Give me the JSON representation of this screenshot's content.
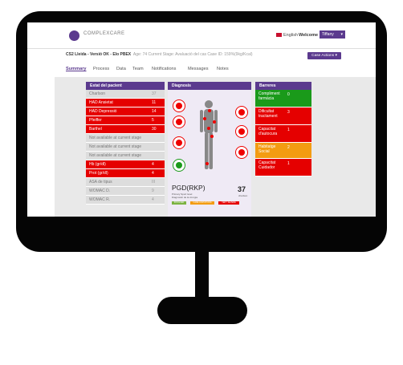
{
  "header": {
    "logo_text": "COMPLEXCARE",
    "language": "English",
    "welcome_label": "Welcome",
    "user_name": "Tiffany"
  },
  "case": {
    "title": "CS2 Lleida - Versió OK - Elo PBEX",
    "meta": "Age: 74  Current Stage: Avaluació del cas  Case ID: 159%(9kg/Kcal)",
    "actions_label": "Case Actions"
  },
  "tabs": [
    "Summary",
    "Process",
    "Data",
    "Team",
    "Notifications",
    "Messages",
    "Notes"
  ],
  "patient_panel": {
    "title": "Estat del pacient",
    "rows": [
      {
        "label": "Charlson",
        "value": "37",
        "status": "grey"
      },
      {
        "label": "HAD Ansietat",
        "value": "11",
        "status": "red"
      },
      {
        "label": "HAD Depressió",
        "value": "14",
        "status": "red"
      },
      {
        "label": "Pfeiffer",
        "value": "5",
        "status": "red"
      },
      {
        "label": "Barthel",
        "value": "30",
        "status": "red"
      },
      {
        "label": "Not available at current stage",
        "value": "",
        "status": "grey"
      },
      {
        "label": "Not available at current stage",
        "value": "",
        "status": "grey"
      },
      {
        "label": "Not available at current stage",
        "value": "",
        "status": "grey"
      },
      {
        "label": "Hb (gr/dl)",
        "value": "4",
        "status": "red"
      },
      {
        "label": "Prot (gr/dl)",
        "value": "4",
        "status": "red"
      },
      {
        "label": "ASA de tipus",
        "value": "III",
        "status": "grey"
      },
      {
        "label": "WOMAC D.",
        "value": "9",
        "status": "grey"
      },
      {
        "label": "WOMAC R.",
        "value": "4",
        "status": "grey"
      }
    ]
  },
  "diagnosis_panel": {
    "title": "Diagnosis",
    "pgd_label": "PGD(RKP)",
    "pgd_sub1": "Primary Sport level",
    "pgd_sub2": "Diagnostic de la cirurgia",
    "count": "37",
    "count_label": "charlson",
    "legend": [
      "INVOLVED",
      "CARE LIMITATIONS",
      "VERY SEVERE"
    ]
  },
  "barriers_panel": {
    "title": "Barreres",
    "rows": [
      {
        "label": "Compliment farmàcia",
        "value": "0",
        "color": "#1a9a1a"
      },
      {
        "label": "Dificultat tractament",
        "value": "3",
        "color": "#e50000"
      },
      {
        "label": "Capacitat d'autocura",
        "value": "1",
        "color": "#e50000"
      },
      {
        "label": "Habitatge Social",
        "value": "2",
        "color": "#f39c12"
      },
      {
        "label": "Capacitat Cuidador",
        "value": "1",
        "color": "#e50000"
      }
    ]
  },
  "colors": {
    "accent": "#5b3a8e",
    "red": "#e50000",
    "green": "#1a9a1a",
    "orange": "#f39c12"
  }
}
